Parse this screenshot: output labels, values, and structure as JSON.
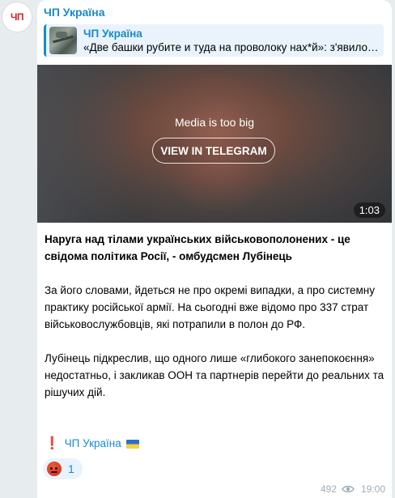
{
  "channel": {
    "avatar_label": "ЧП",
    "name": "ЧП Україна"
  },
  "reply": {
    "title": "ЧП Україна",
    "quote": "«Две башки рубите и туда на проволоку нах*й»: з'явилось відео"
  },
  "media": {
    "notice": "Media is too big",
    "view_button": "VIEW IN TELEGRAM",
    "duration": "1:03"
  },
  "post": {
    "headline": "Наруга над тілами українських військовополонених - це свідома політика Росії, - омбудсмен Лубінець",
    "paragraph1": "За його словами, йдеться не про окремі випадки, а про системну практику російської армії. На сьогодні вже відомо про 337 страт військовослужбовців, які потрапили в полон до РФ.",
    "paragraph2": "Лубінець підкреслив, що одного лише «глибокого занепокоєння» недостатньо, і закликав ООН та партнерів перейти до реальних та рішучих дій.",
    "signature_mark": "❗",
    "signature_link": "ЧП Україна"
  },
  "reaction": {
    "icon": "angry-face-icon",
    "count": "1"
  },
  "meta": {
    "views": "492",
    "time": "19:00"
  },
  "colors": {
    "accent": "#168acd",
    "background": "#e7ecef",
    "bubble": "#ffffff"
  }
}
